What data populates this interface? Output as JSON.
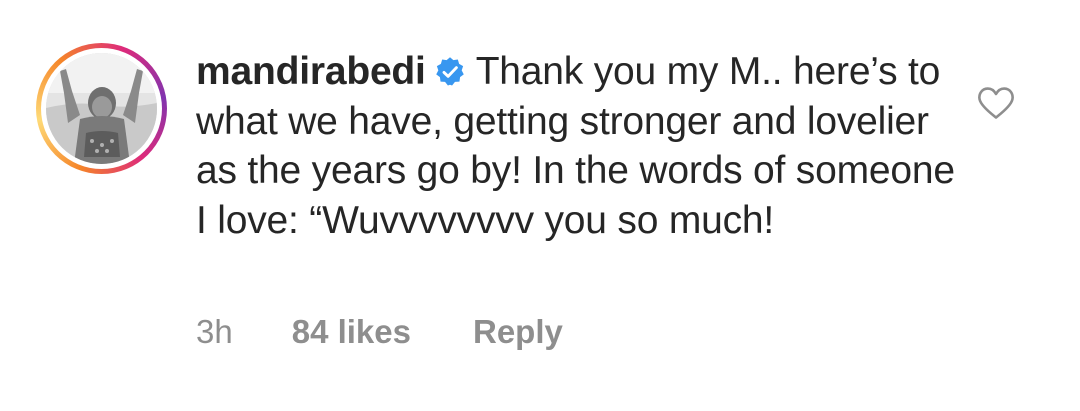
{
  "comment": {
    "username": "mandirabedi",
    "verified": true,
    "text": "Thank you my M.. here’s to what we have, getting stronger and lovelier as the years go by! In the words of someone I love: “Wuvvvvvvvv you so much!",
    "time": "3h",
    "likes": "84 likes",
    "reply_label": "Reply"
  },
  "icons": {
    "verified": "verified-badge-icon",
    "like": "heart-outline-icon"
  },
  "colors": {
    "verified_blue": "#3897f0",
    "meta_gray": "#8e8e8e",
    "text": "#262626"
  }
}
